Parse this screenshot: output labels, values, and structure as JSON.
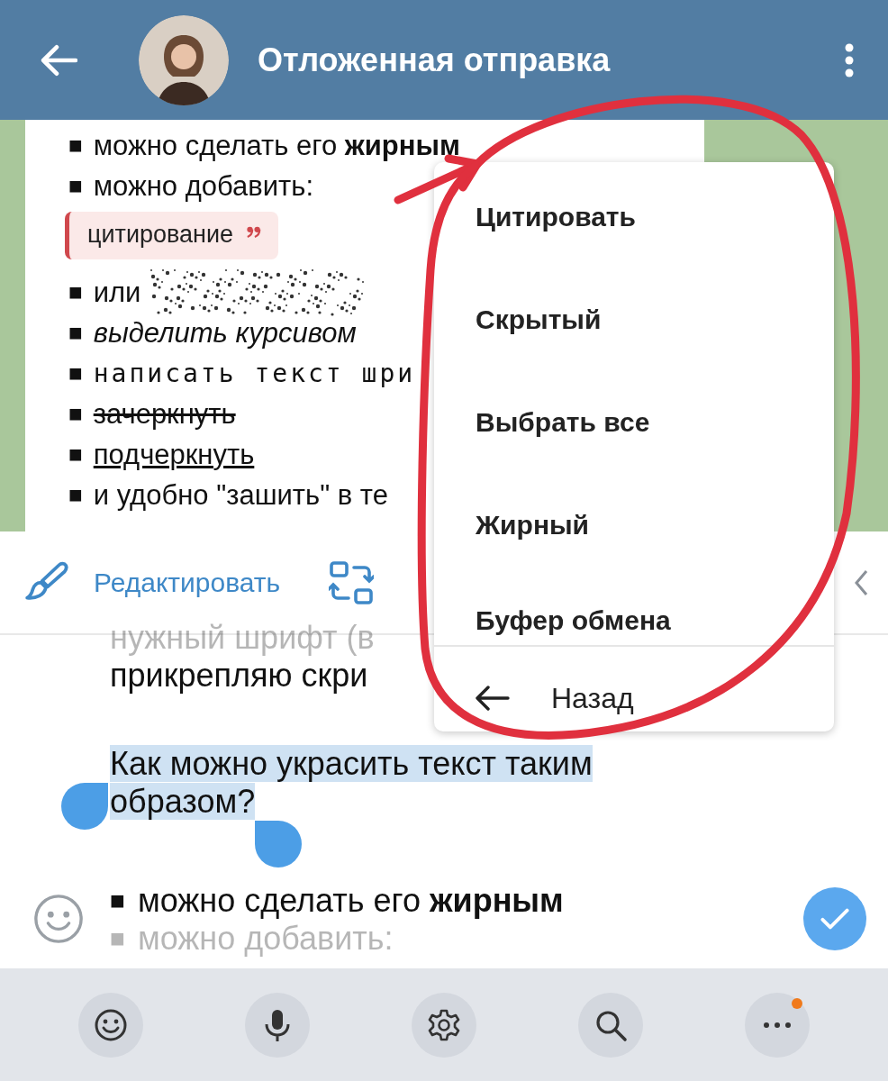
{
  "header": {
    "title": "Отложенная отправка"
  },
  "bubble": {
    "lines": [
      {
        "bullet": "■",
        "text": "можно сделать его **жирным**",
        "kind": "plain",
        "spoiler": false
      },
      {
        "bullet": "■",
        "text": "можно добавить:",
        "kind": "plain",
        "spoiler": false
      },
      {
        "text": "цитирование",
        "kind": "quote"
      },
      {
        "bullet": "■",
        "text": "или",
        "kind": "plain",
        "spoiler": true
      },
      {
        "bullet": "■",
        "text": "выделить курсивом",
        "kind": "italic",
        "spoiler": false
      },
      {
        "bullet": "■",
        "text": "написать текст шри",
        "kind": "mono",
        "spoiler": false
      },
      {
        "bullet": "■",
        "text": "зачеркнуть",
        "kind": "strike",
        "spoiler": false
      },
      {
        "bullet": "■",
        "text": "подчеркнуть",
        "kind": "underline",
        "spoiler": false
      },
      {
        "bullet": "■",
        "text": "и удобно \"зашить\" в те",
        "kind": "plain",
        "spoiler": false
      }
    ]
  },
  "toolbar": {
    "edit_label": "Редактировать"
  },
  "menu": {
    "items": [
      "Цитировать",
      "Скрытый",
      "Выбрать все",
      "Жирный",
      "Буфер обмена"
    ],
    "back_label": "Назад"
  },
  "input": {
    "paragraphs": [
      {
        "lines": [
          {
            "text": "нужный шрифт (в",
            "selected": false,
            "faded": true
          },
          {
            "text": "прикрепляю скри",
            "selected": false,
            "faded": false
          }
        ]
      },
      {
        "lines": [
          {
            "text": "Как можно украсить текст таким",
            "selected": true,
            "faded": false
          },
          {
            "text": "образом?",
            "selected": true,
            "faded": false
          }
        ]
      },
      {
        "lines": [
          {
            "bullet": "■",
            "text": "можно сделать его **жирным**",
            "selected": false,
            "faded": false
          },
          {
            "bullet": "■",
            "text": "можно добавить:",
            "selected": false,
            "faded": true
          }
        ]
      }
    ]
  },
  "keyboard_bar": {
    "more_has_badge": true
  }
}
